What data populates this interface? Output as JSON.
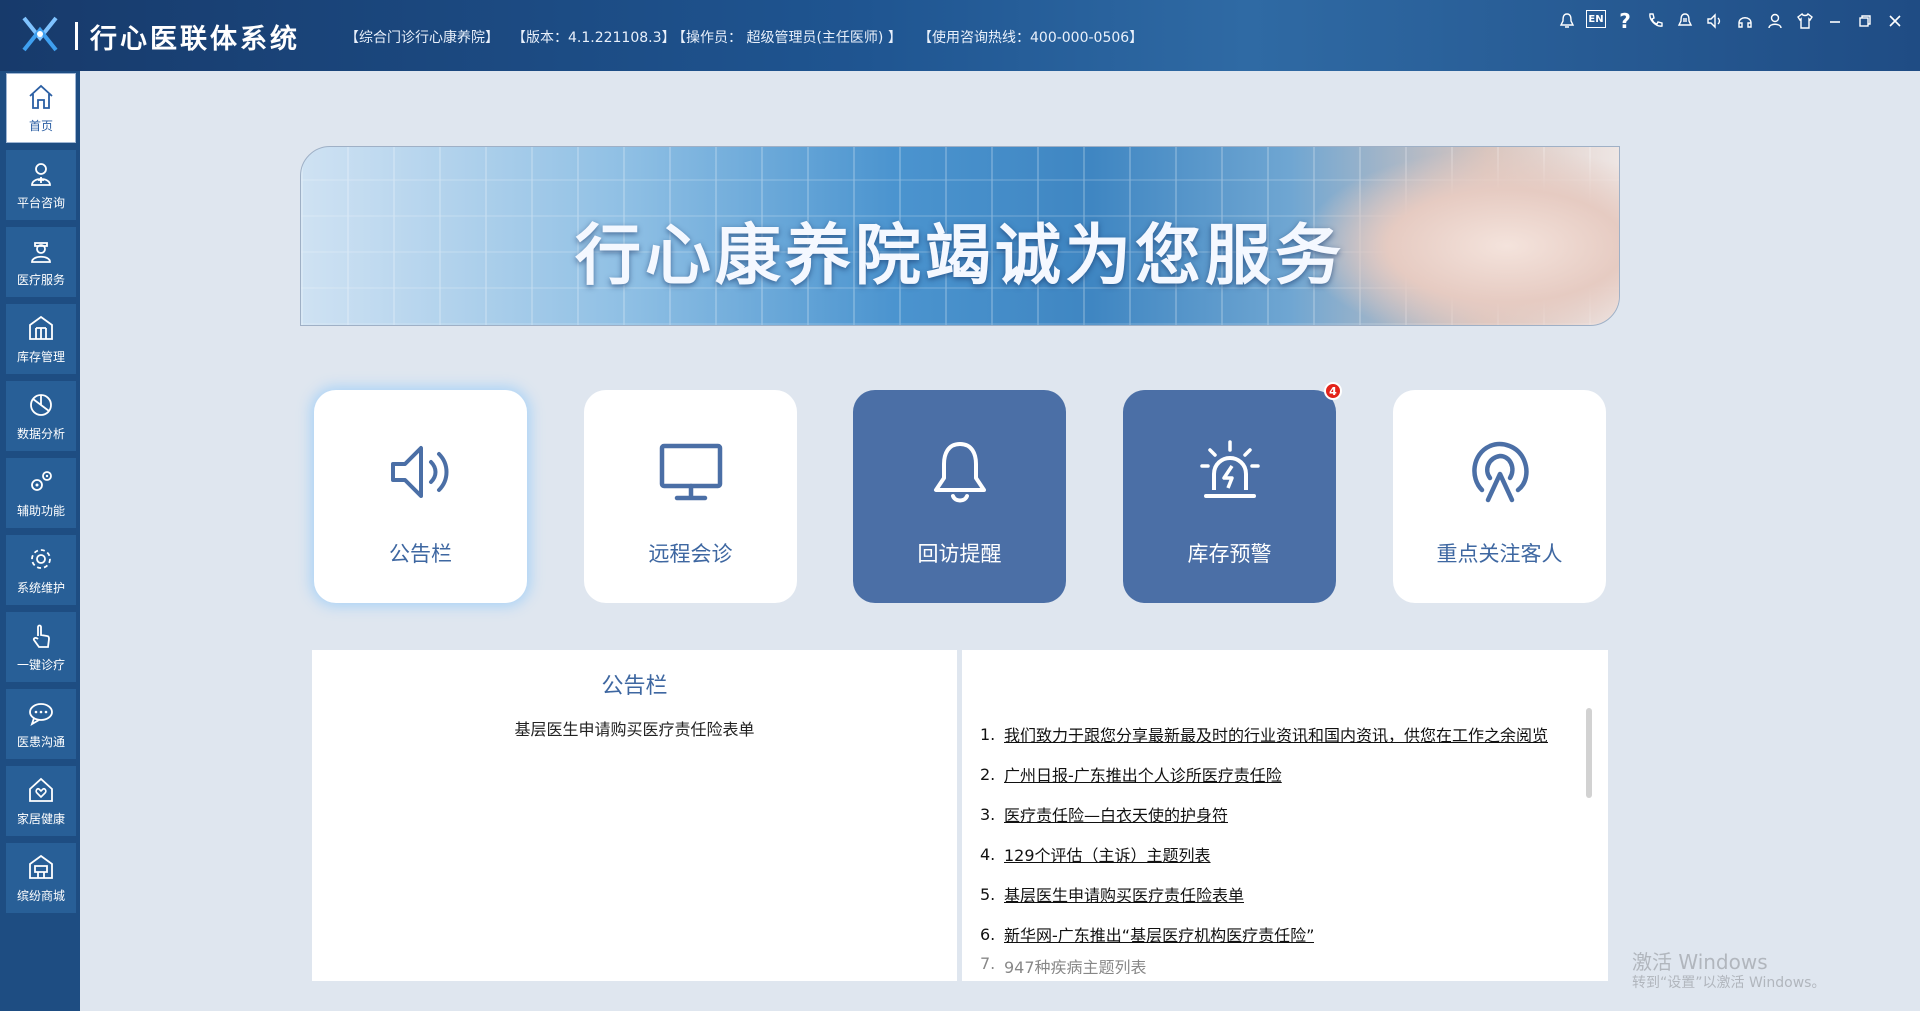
{
  "header": {
    "app_title": "行心医联体系统",
    "info": [
      "【综合门诊行心康养院】",
      "【版本：4.1.221108.3】",
      "【操作员：  超级管理员(主任医师) 】",
      "【使用咨询热线：400-000-0506】"
    ],
    "lang_toggle": "EN",
    "help_label": "?"
  },
  "sidebar": {
    "items": [
      {
        "label": "首页",
        "icon": "home-icon"
      },
      {
        "label": "平台咨询",
        "icon": "doctor-icon"
      },
      {
        "label": "医疗服务",
        "icon": "nurse-icon"
      },
      {
        "label": "库存管理",
        "icon": "warehouse-icon"
      },
      {
        "label": "数据分析",
        "icon": "pie-chart-icon"
      },
      {
        "label": "辅助功能",
        "icon": "gears-icon"
      },
      {
        "label": "系统维护",
        "icon": "settings-icon"
      },
      {
        "label": "一键诊疗",
        "icon": "touch-icon"
      },
      {
        "label": "医患沟通",
        "icon": "chat-icon"
      },
      {
        "label": "家居健康",
        "icon": "home-heart-icon"
      },
      {
        "label": "缤纷商城",
        "icon": "store-icon"
      }
    ]
  },
  "banner": {
    "text": "行心康养院竭诚为您服务"
  },
  "tiles": [
    {
      "label": "公告栏",
      "icon": "speaker-icon"
    },
    {
      "label": "远程会诊",
      "icon": "monitor-icon"
    },
    {
      "label": "回访提醒",
      "icon": "bell-icon"
    },
    {
      "label": "库存预警",
      "icon": "alarm-light-icon",
      "badge": "4"
    },
    {
      "label": "重点关注客人",
      "icon": "signal-person-icon"
    }
  ],
  "announcement": {
    "title": "公告栏",
    "content": "基层医生申请购买医疗责任险表单"
  },
  "news": [
    {
      "num": "1.",
      "text": "我们致力于跟您分享最新最及时的行业资讯和国内资讯，供您在工作之余阅览"
    },
    {
      "num": "2.",
      "text": "广州日报-广东推出个人诊所医疗责任险"
    },
    {
      "num": "3.",
      "text": "医疗责任险—白衣天使的护身符"
    },
    {
      "num": "4.",
      "text": "129个评估（主诉）主题列表"
    },
    {
      "num": "5.",
      "text": "基层医生申请购买医疗责任险表单"
    },
    {
      "num": "6.",
      "text": "新华网-广东推出“基层医疗机构医疗责任险”"
    },
    {
      "num": "7.",
      "text": "947种疾病主题列表"
    }
  ],
  "watermark": {
    "line1": "激活 Windows",
    "line2": "转到“设置”以激活 Windows。"
  },
  "colors": {
    "titlebar": "#1f5591",
    "sidebar": "#1e4d82",
    "accent": "#3e67a1",
    "tile_dark": "#4b6fa6",
    "badge": "#e3231a"
  }
}
